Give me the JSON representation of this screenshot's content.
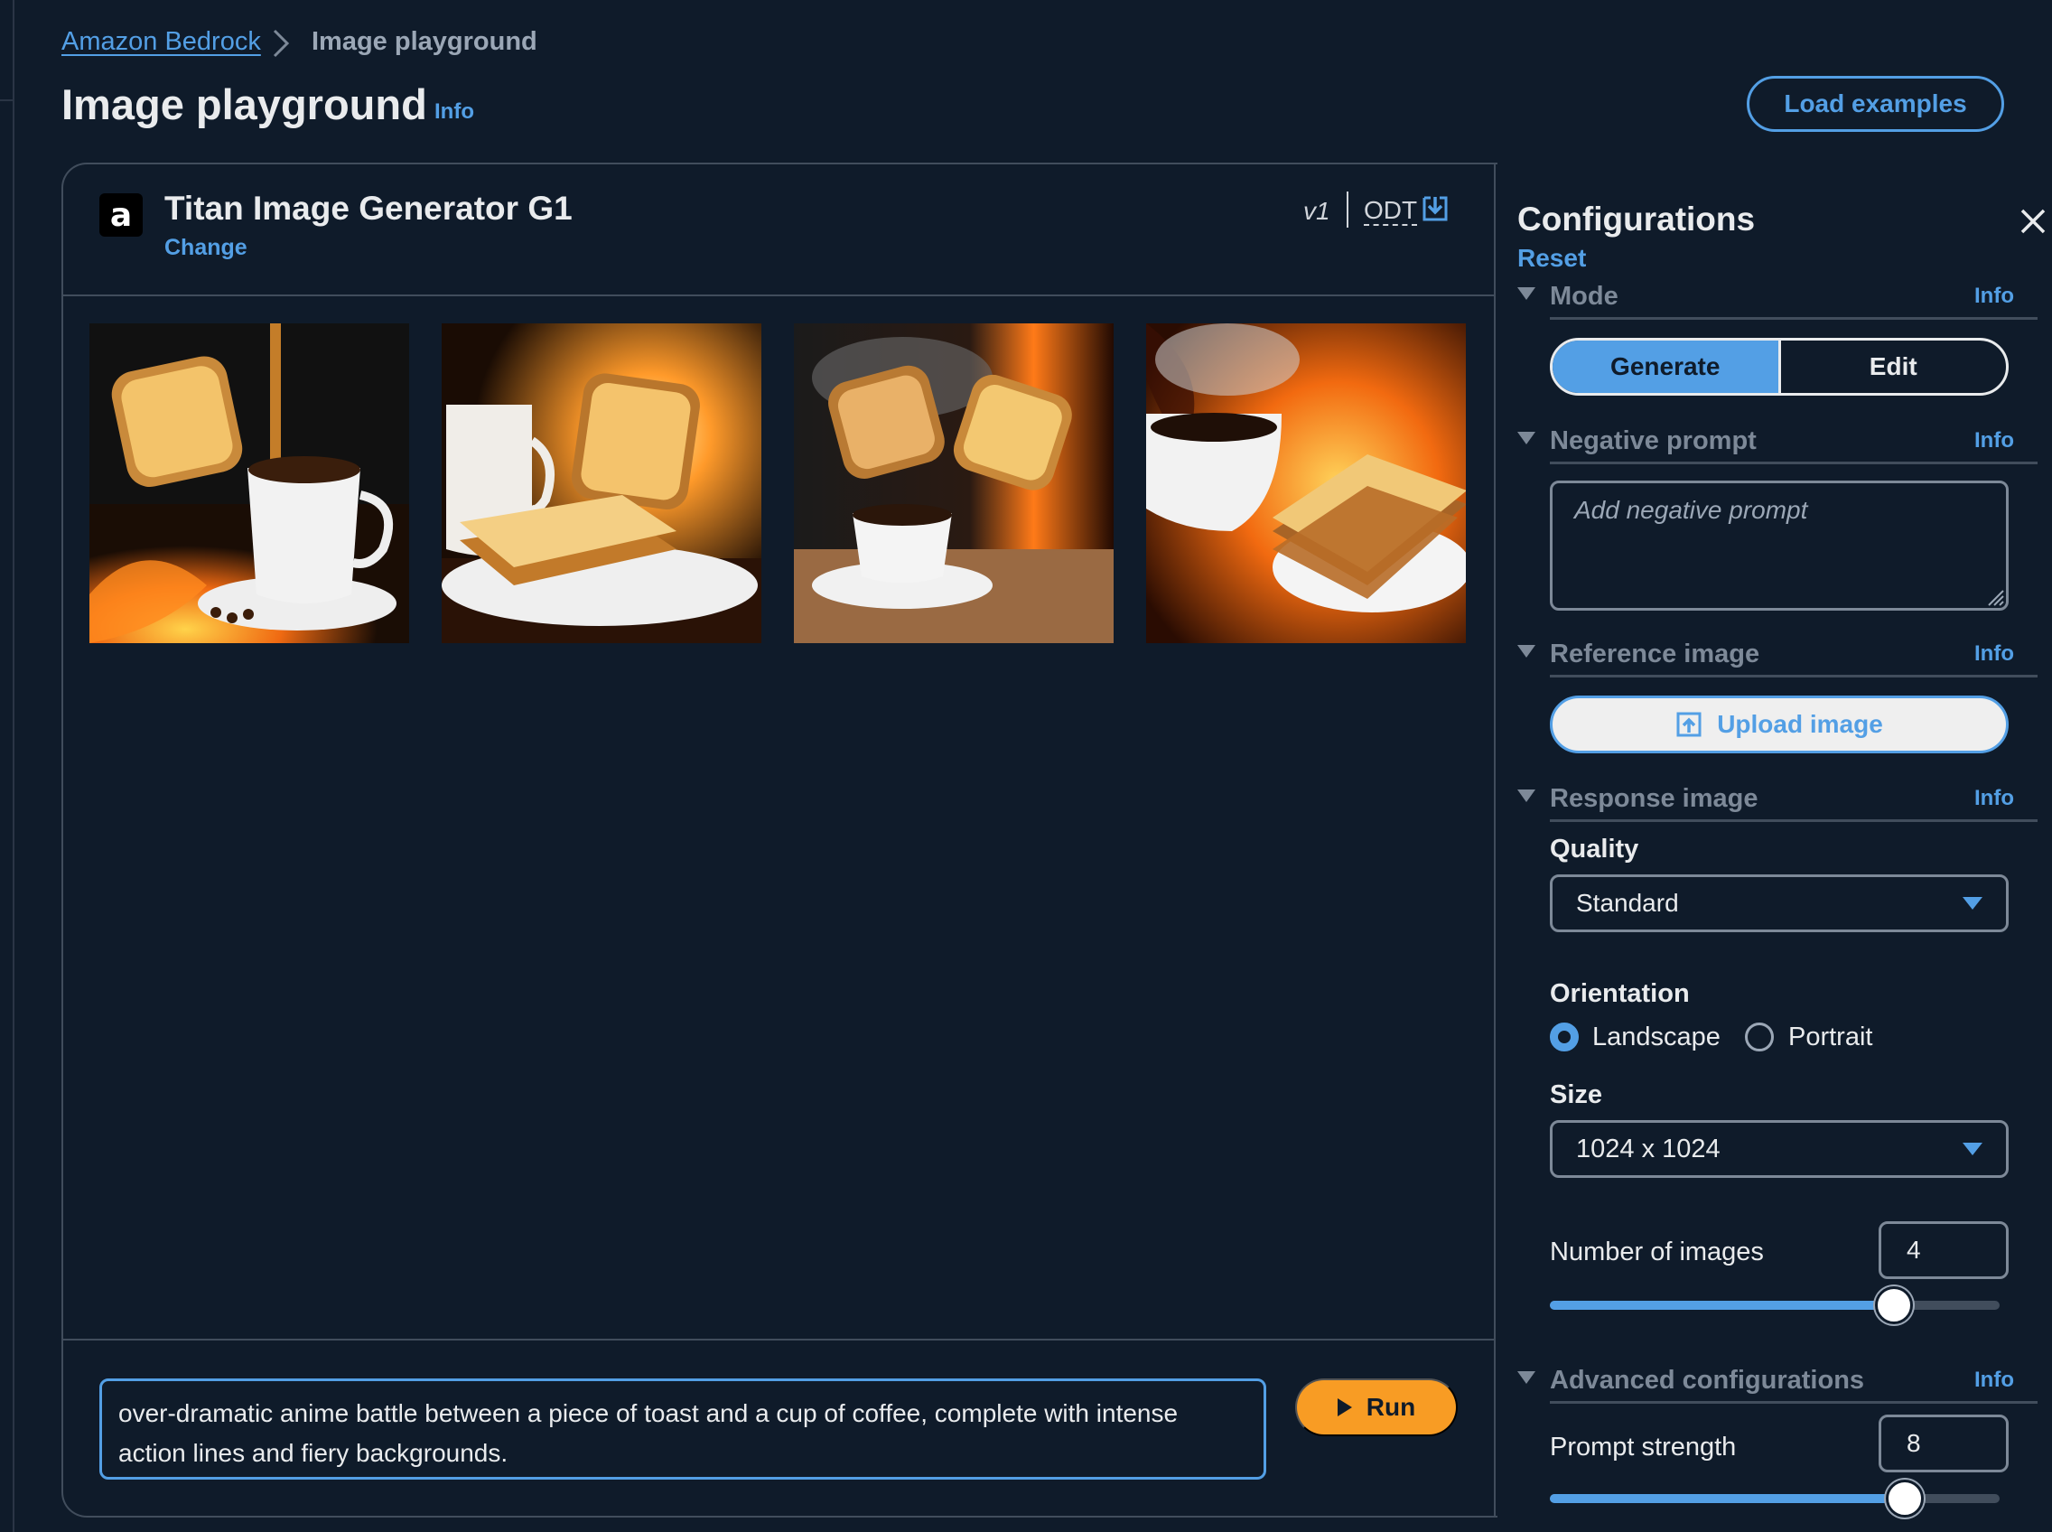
{
  "breadcrumb": {
    "root": "Amazon Bedrock",
    "current": "Image playground"
  },
  "page": {
    "title": "Image playground",
    "info": "Info",
    "load_examples": "Load examples"
  },
  "model": {
    "name": "Titan Image Generator G1",
    "change": "Change",
    "version": "v1",
    "odt": "ODT",
    "logo_letter": "a"
  },
  "prompt": {
    "text": "over-dramatic anime battle between a piece of toast and a cup of coffee, complete with intense action lines and fiery backgrounds.",
    "run": "Run"
  },
  "config": {
    "title": "Configurations",
    "reset": "Reset",
    "mode": {
      "label": "Mode",
      "info": "Info",
      "options": [
        "Generate",
        "Edit"
      ],
      "selected": "Generate"
    },
    "negative": {
      "label": "Negative prompt",
      "info": "Info",
      "placeholder": "Add negative prompt"
    },
    "reference": {
      "label": "Reference image",
      "info": "Info",
      "upload": "Upload image"
    },
    "response": {
      "label": "Response image",
      "info": "Info",
      "quality_label": "Quality",
      "quality_value": "Standard",
      "orientation_label": "Orientation",
      "orientation_options": [
        "Landscape",
        "Portrait"
      ],
      "orientation_selected": "Landscape",
      "size_label": "Size",
      "size_value": "1024 x 1024",
      "num_images_label": "Number of images",
      "num_images_value": "4"
    },
    "advanced": {
      "label": "Advanced configurations",
      "info": "Info",
      "prompt_strength_label": "Prompt strength",
      "prompt_strength_value": "8"
    }
  },
  "colors": {
    "accent": "#539fe5",
    "run": "#f89c24",
    "bg": "#0f1b2a"
  }
}
